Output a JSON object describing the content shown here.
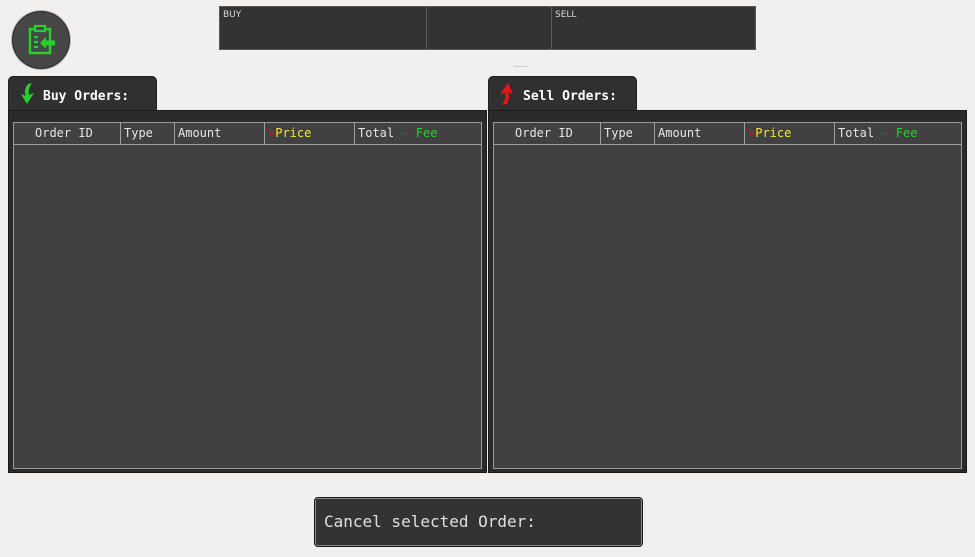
{
  "logo": {
    "icon": "clipboard-arrow-icon",
    "color": "#25d12a"
  },
  "ticker": {
    "buy_label": "BUY",
    "middle_label": "",
    "sell_label": "SELL"
  },
  "buy_orders": {
    "title": "Buy Orders:",
    "icon": "green-down-arrow-icon",
    "columns": {
      "order_id": "Order ID",
      "type": "Type",
      "amount": "Amount",
      "price_marker": "¤",
      "price": "Price",
      "total": "Total",
      "minus": "–",
      "fee": "Fee"
    },
    "rows": []
  },
  "sell_orders": {
    "title": "Sell Orders:",
    "icon": "red-up-arrow-icon",
    "columns": {
      "order_id": "Order ID",
      "type": "Type",
      "amount": "Amount",
      "price_marker": "¤",
      "price": "Price",
      "total": "Total",
      "minus": "–",
      "fee": "Fee"
    },
    "rows": []
  },
  "cancel": {
    "label": "Cancel selected Order:"
  },
  "colors": {
    "red": "#e01818",
    "yellow": "#f2ea2a",
    "green": "#25d12a"
  }
}
